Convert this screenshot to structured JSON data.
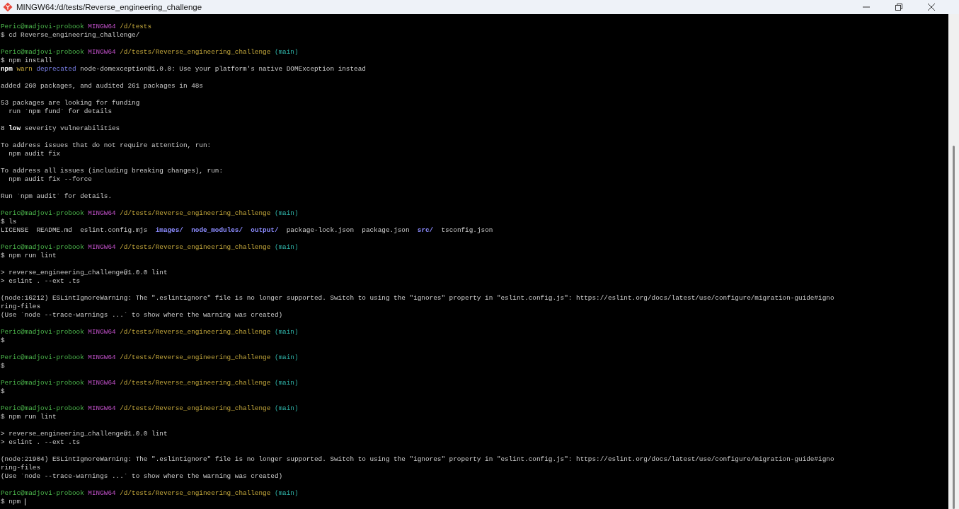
{
  "window": {
    "title": "MINGW64:/d/tests/Reverse_engineering_challenge"
  },
  "terminal": {
    "blocks": [
      {
        "lines": [
          {
            "prompt": {
              "user": "Peric@madjovi-probook",
              "host": "MINGW64",
              "path": "/d/tests"
            }
          },
          {
            "segments": [
              {
                "text": "$ cd Reverse_engineering_challenge/"
              }
            ]
          }
        ]
      },
      {
        "lines": [
          {
            "prompt": {
              "user": "Peric@madjovi-probook",
              "host": "MINGW64",
              "path": "/d/tests/Reverse_engineering_challenge",
              "branch": "(main)"
            }
          },
          {
            "segments": [
              {
                "text": "$ npm install"
              }
            ]
          },
          {
            "segments": [
              {
                "text": "npm",
                "kind": "bold"
              },
              {
                "text": " warn",
                "kind": "warn"
              },
              {
                "text": " deprecated",
                "kind": "deprecated"
              },
              {
                "text": " node-domexception@1.0.0: Use your platform's native DOMException instead"
              }
            ]
          }
        ]
      },
      {
        "lines": [
          {
            "segments": [
              {
                "text": "added 260 packages, and audited 261 packages in 48s"
              }
            ]
          }
        ]
      },
      {
        "lines": [
          {
            "segments": [
              {
                "text": "53 packages are looking for funding"
              }
            ]
          },
          {
            "segments": [
              {
                "text": "  run `npm fund` for details"
              }
            ]
          }
        ]
      },
      {
        "lines": [
          {
            "segments": [
              {
                "text": "8 "
              },
              {
                "text": "low",
                "kind": "bold"
              },
              {
                "text": " severity vulnerabilities"
              }
            ]
          }
        ]
      },
      {
        "lines": [
          {
            "segments": [
              {
                "text": "To address issues that do not require attention, run:"
              }
            ]
          },
          {
            "segments": [
              {
                "text": "  npm audit fix"
              }
            ]
          }
        ]
      },
      {
        "lines": [
          {
            "segments": [
              {
                "text": "To address all issues (including breaking changes), run:"
              }
            ]
          },
          {
            "segments": [
              {
                "text": "  npm audit fix --force"
              }
            ]
          }
        ]
      },
      {
        "lines": [
          {
            "segments": [
              {
                "text": "Run `npm audit` for details."
              }
            ]
          }
        ]
      },
      {
        "lines": [
          {
            "prompt": {
              "user": "Peric@madjovi-probook",
              "host": "MINGW64",
              "path": "/d/tests/Reverse_engineering_challenge",
              "branch": "(main)"
            }
          },
          {
            "segments": [
              {
                "text": "$ ls"
              }
            ]
          },
          {
            "segments": [
              {
                "text": "LICENSE  README.md  eslint.config.mjs  "
              },
              {
                "text": "images/",
                "kind": "dir"
              },
              {
                "text": "  node_modules/",
                "kind": "dir"
              },
              {
                "text": "  output/",
                "kind": "dir"
              },
              {
                "text": "  package-lock.json  package.json  "
              },
              {
                "text": "src/",
                "kind": "dir"
              },
              {
                "text": "  tsconfig.json"
              }
            ]
          }
        ]
      },
      {
        "lines": [
          {
            "prompt": {
              "user": "Peric@madjovi-probook",
              "host": "MINGW64",
              "path": "/d/tests/Reverse_engineering_challenge",
              "branch": "(main)"
            }
          },
          {
            "segments": [
              {
                "text": "$ npm run lint"
              }
            ]
          }
        ]
      },
      {
        "lines": [
          {
            "segments": [
              {
                "text": "> reverse_engineering_challenge@1.0.0 lint"
              }
            ]
          },
          {
            "segments": [
              {
                "text": "> eslint . --ext .ts"
              }
            ]
          }
        ]
      },
      {
        "lines": [
          {
            "segments": [
              {
                "text": "(node:16212) ESLintIgnoreWarning: The \".eslintignore\" file is no longer supported. Switch to using the \"ignores\" property in \"eslint.config.js\": https://eslint.org/docs/latest/use/configure/migration-guide#igno"
              }
            ]
          },
          {
            "segments": [
              {
                "text": "ring-files"
              }
            ]
          },
          {
            "segments": [
              {
                "text": "(Use `node --trace-warnings ...` to show where the warning was created)"
              }
            ]
          }
        ]
      },
      {
        "lines": [
          {
            "prompt": {
              "user": "Peric@madjovi-probook",
              "host": "MINGW64",
              "path": "/d/tests/Reverse_engineering_challenge",
              "branch": "(main)"
            }
          },
          {
            "segments": [
              {
                "text": "$"
              }
            ]
          }
        ]
      },
      {
        "lines": [
          {
            "prompt": {
              "user": "Peric@madjovi-probook",
              "host": "MINGW64",
              "path": "/d/tests/Reverse_engineering_challenge",
              "branch": "(main)"
            }
          },
          {
            "segments": [
              {
                "text": "$"
              }
            ]
          }
        ]
      },
      {
        "lines": [
          {
            "prompt": {
              "user": "Peric@madjovi-probook",
              "host": "MINGW64",
              "path": "/d/tests/Reverse_engineering_challenge",
              "branch": "(main)"
            }
          },
          {
            "segments": [
              {
                "text": "$"
              }
            ]
          }
        ]
      },
      {
        "lines": [
          {
            "prompt": {
              "user": "Peric@madjovi-probook",
              "host": "MINGW64",
              "path": "/d/tests/Reverse_engineering_challenge",
              "branch": "(main)"
            }
          },
          {
            "segments": [
              {
                "text": "$ npm run lint"
              }
            ]
          }
        ]
      },
      {
        "lines": [
          {
            "segments": [
              {
                "text": "> reverse_engineering_challenge@1.0.0 lint"
              }
            ]
          },
          {
            "segments": [
              {
                "text": "> eslint . --ext .ts"
              }
            ]
          }
        ]
      },
      {
        "lines": [
          {
            "segments": [
              {
                "text": "(node:21904) ESLintIgnoreWarning: The \".eslintignore\" file is no longer supported. Switch to using the \"ignores\" property in \"eslint.config.js\": https://eslint.org/docs/latest/use/configure/migration-guide#igno"
              }
            ]
          },
          {
            "segments": [
              {
                "text": "ring-files"
              }
            ]
          },
          {
            "segments": [
              {
                "text": "(Use `node --trace-warnings ...` to show where the warning was created)"
              }
            ]
          }
        ]
      },
      {
        "lines": [
          {
            "prompt": {
              "user": "Peric@madjovi-probook",
              "host": "MINGW64",
              "path": "/d/tests/Reverse_engineering_challenge",
              "branch": "(main)"
            }
          },
          {
            "segments": [
              {
                "text": "$ npm"
              }
            ],
            "cursor": true
          }
        ]
      }
    ]
  }
}
